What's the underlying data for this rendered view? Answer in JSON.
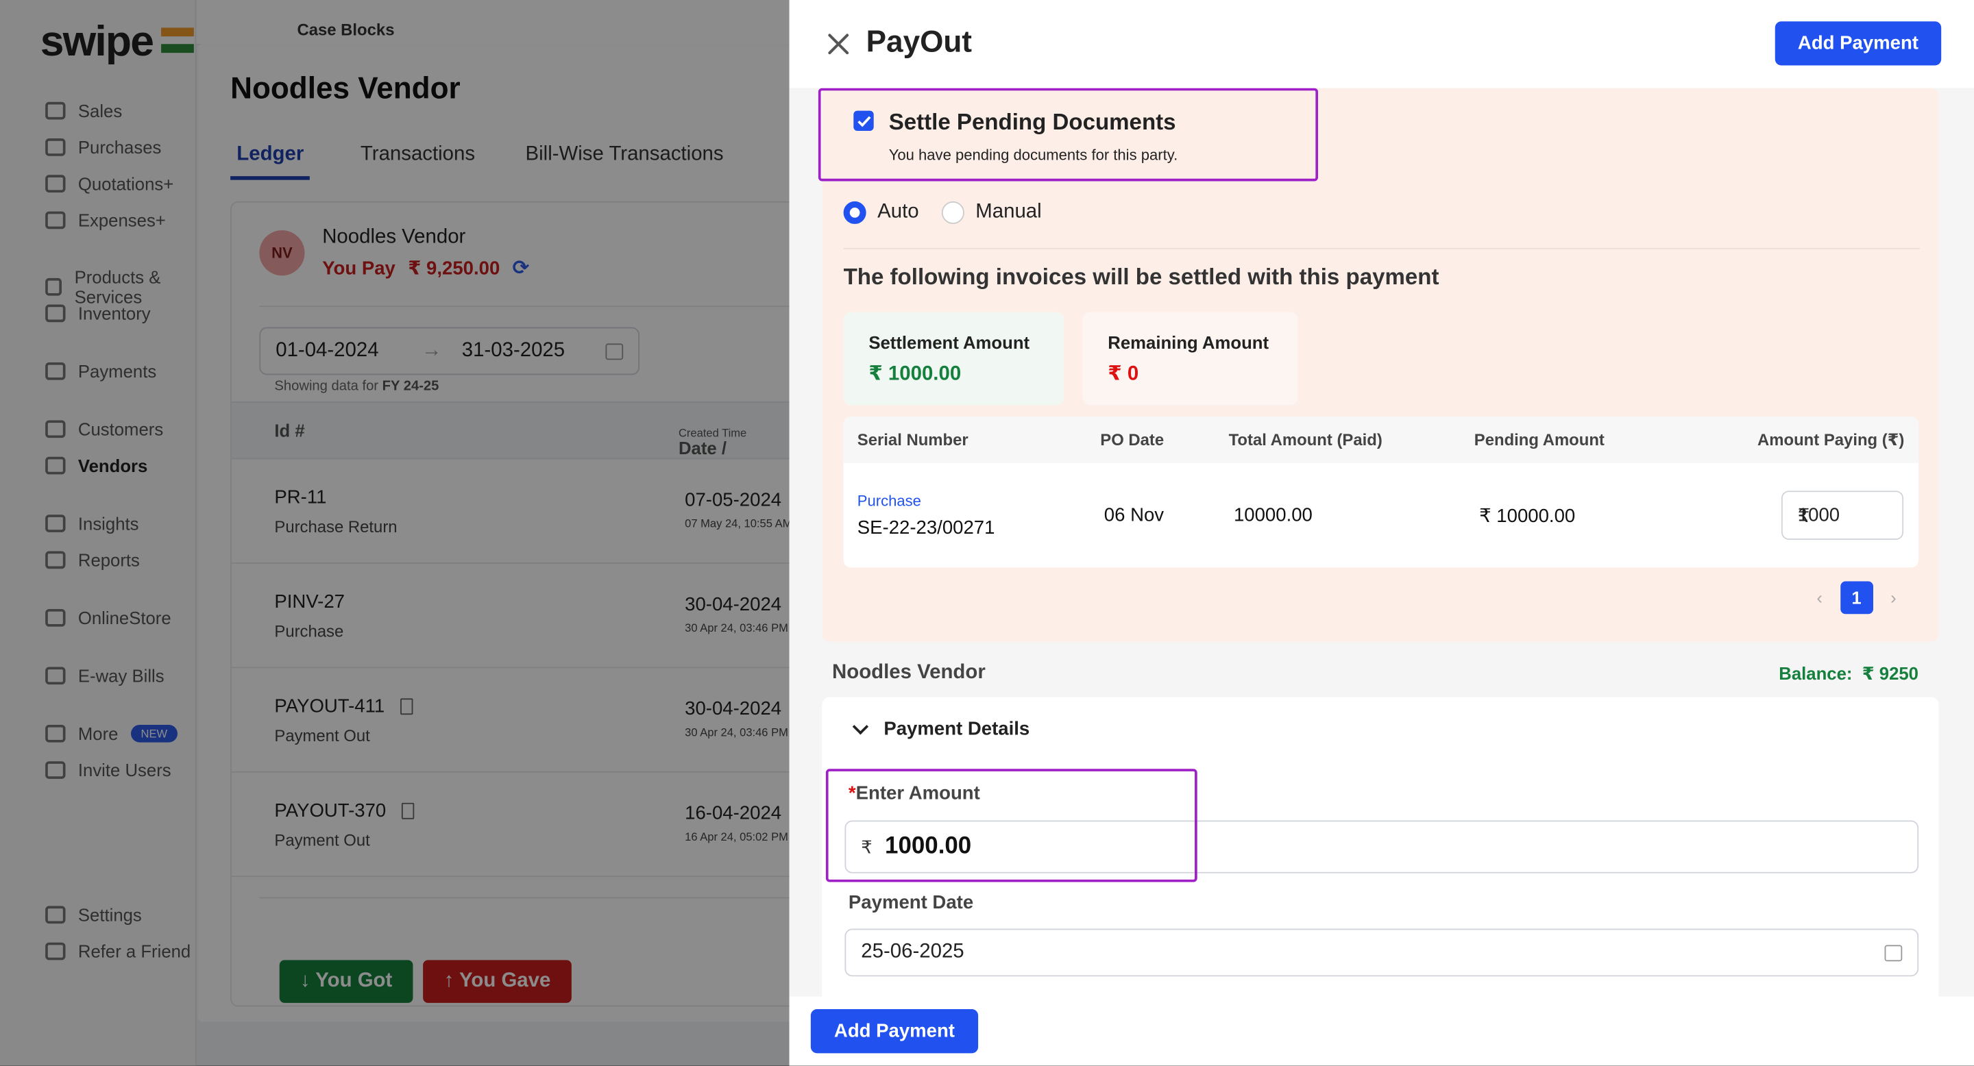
{
  "app": {
    "logo": "swipe",
    "breadcrumb": "Case Blocks",
    "nav": [
      {
        "label": "Sales"
      },
      {
        "label": "Purchases"
      },
      {
        "label": "Quotations+"
      },
      {
        "label": "Expenses+"
      },
      {
        "label": "Products & Services"
      },
      {
        "label": "Inventory"
      },
      {
        "label": "Payments"
      },
      {
        "label": "Customers"
      },
      {
        "label": "Vendors"
      },
      {
        "label": "Insights"
      },
      {
        "label": "Reports"
      },
      {
        "label": "OnlineStore"
      },
      {
        "label": "E-way Bills"
      },
      {
        "label": "More"
      },
      {
        "label": "Invite Users"
      },
      {
        "label": "Settings"
      },
      {
        "label": "Refer a Friend"
      }
    ],
    "more_badge": "NEW"
  },
  "vendor": {
    "title": "Noodles Vendor",
    "tabs": [
      {
        "label": "Ledger"
      },
      {
        "label": "Transactions"
      },
      {
        "label": "Bill-Wise Transactions"
      }
    ],
    "avatar": "NV",
    "name": "Noodles Vendor",
    "you_pay_label": "You Pay",
    "you_pay_amount": "₹ 9,250.00",
    "date_from": "01-04-2024",
    "date_to": "31-03-2025",
    "showing_prefix": "Showing data for",
    "showing_fy": "FY 24-25",
    "col_id": "Id #",
    "col_date": "Date /",
    "col_date_small": "Created Time",
    "rows": [
      {
        "id": "PR-11",
        "type": "Purchase Return",
        "date": "07-05-2024",
        "time": "07 May 24, 10:55 AM"
      },
      {
        "id": "PINV-27",
        "type": "Purchase",
        "date": "30-04-2024",
        "time": "30 Apr 24, 03:46 PM"
      },
      {
        "id": "PAYOUT-411",
        "type": "Payment Out",
        "date": "30-04-2024",
        "time": "30 Apr 24, 03:46 PM"
      },
      {
        "id": "PAYOUT-370",
        "type": "Payment Out",
        "date": "16-04-2024",
        "time": "16 Apr 24, 05:02 PM"
      }
    ],
    "you_got": "↓ You Got",
    "you_gave": "↑ You Gave"
  },
  "payout": {
    "title": "PayOut",
    "add_payment": "Add Payment",
    "settle_title": "Settle Pending Documents",
    "settle_sub": "You have pending documents for this party.",
    "mode_auto": "Auto",
    "mode_manual": "Manual",
    "settle_message": "The following invoices will be settled with this payment",
    "settlement_label": "Settlement Amount",
    "settlement_value": "₹  1000.00",
    "remaining_label": "Remaining Amount",
    "remaining_value": "₹  0",
    "table_headers": {
      "serial": "Serial Number",
      "po_date": "PO Date",
      "total": "Total Amount (Paid)",
      "pending": "Pending Amount",
      "paying": "Amount Paying (₹)"
    },
    "invoice": {
      "doc_type": "Purchase",
      "serial": "SE-22-23/00271",
      "po_date": "06 Nov",
      "total": "10000.00",
      "pending": "₹ 10000.00",
      "paying_currency": "₹",
      "paying_value": "1000"
    },
    "page": "1",
    "party_name": "Noodles Vendor",
    "balance_label": "Balance:",
    "balance_value": "₹ 9250",
    "payment_details": "Payment Details",
    "amount_label": "Enter Amount",
    "amount_required": "*",
    "amount_currency": "₹",
    "amount_value": "1000.00",
    "date_label": "Payment Date",
    "date_value": "25-06-2025",
    "colors": {
      "primary": "#2152f0",
      "success": "#15803d",
      "danger": "#c81e1e",
      "highlight": "#a020c8"
    }
  }
}
